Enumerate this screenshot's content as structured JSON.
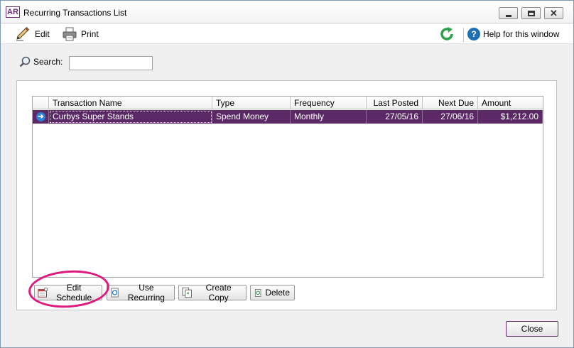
{
  "window": {
    "app_icon_text": "AR",
    "title": "Recurring Transactions List"
  },
  "toolbar": {
    "edit_label": "Edit",
    "print_label": "Print",
    "help_label": "Help for this window"
  },
  "search": {
    "label": "Search:",
    "value": ""
  },
  "grid": {
    "columns": [
      "Transaction Name",
      "Type",
      "Frequency",
      "Last Posted",
      "Next Due",
      "Amount"
    ],
    "rows": [
      {
        "name": "Curbys Super Stands",
        "type": "Spend Money",
        "frequency": "Monthly",
        "last_posted": "27/05/16",
        "next_due": "27/06/16",
        "amount": "$1,212.00",
        "selected": true
      }
    ]
  },
  "actions": {
    "edit_schedule": "Edit Schedule",
    "use_recurring": "Use Recurring",
    "create_copy": "Create Copy",
    "delete": "Delete"
  },
  "footer": {
    "close_label": "Close"
  },
  "colors": {
    "selected_row": "#5b2a66",
    "highlight_ring": "#e0197d"
  }
}
